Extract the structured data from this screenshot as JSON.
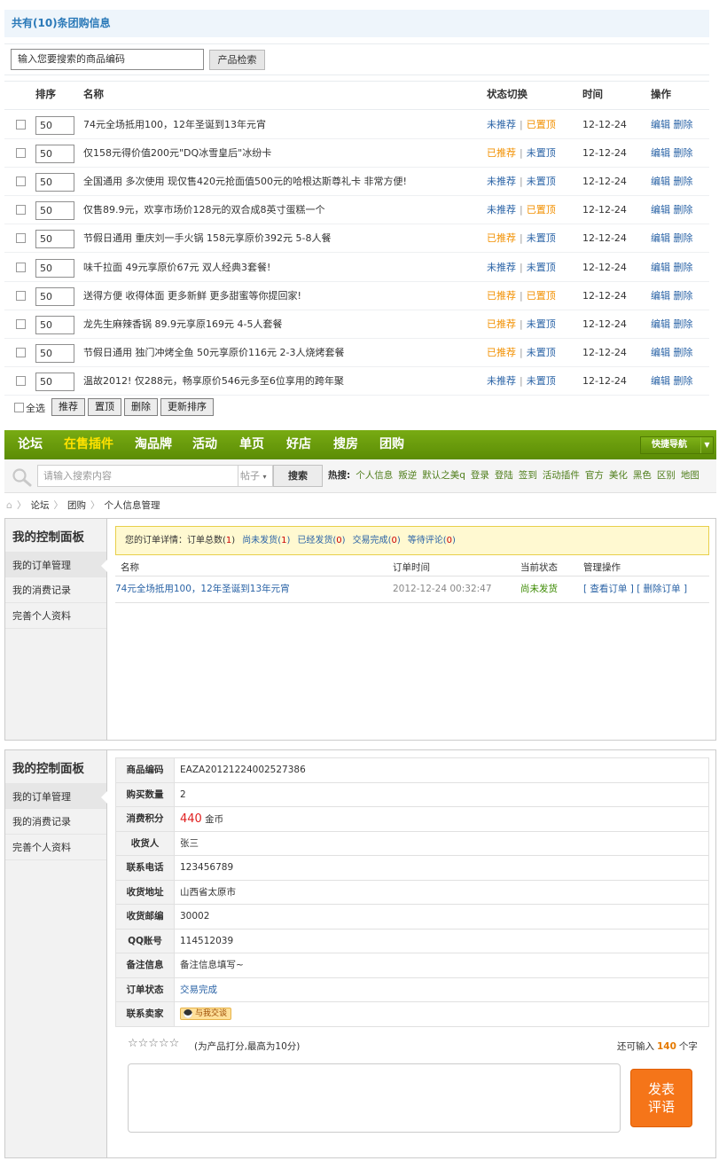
{
  "admin": {
    "header": "共有(10)条团购信息",
    "search": {
      "placeholder": "输入您要搜索的商品编码",
      "button": "产品检索"
    },
    "columns": {
      "order": "排序",
      "name": "名称",
      "status": "状态切换",
      "time": "时间",
      "action": "操作"
    },
    "rows": [
      {
        "order": "50",
        "name": "74元全场抵用100，12年圣诞到13年元宵",
        "rec": "未推荐",
        "rec_on": false,
        "top": "已置顶",
        "top_on": true,
        "time": "12-12-24"
      },
      {
        "order": "50",
        "name": "仅158元得价值200元\"DQ冰雪皇后\"冰纷卡",
        "rec": "已推荐",
        "rec_on": true,
        "top": "未置顶",
        "top_on": false,
        "time": "12-12-24"
      },
      {
        "order": "50",
        "name": "全国通用 多次使用 现仅售420元抢面值500元的哈根达斯尊礼卡 非常方便!",
        "rec": "未推荐",
        "rec_on": false,
        "top": "未置顶",
        "top_on": false,
        "time": "12-12-24"
      },
      {
        "order": "50",
        "name": "仅售89.9元，欢享市场价128元的双合成8英寸蛋糕一个",
        "rec": "未推荐",
        "rec_on": false,
        "top": "已置顶",
        "top_on": true,
        "time": "12-12-24"
      },
      {
        "order": "50",
        "name": "节假日通用 重庆刘一手火锅 158元享原价392元 5-8人餐",
        "rec": "已推荐",
        "rec_on": true,
        "top": "未置顶",
        "top_on": false,
        "time": "12-12-24"
      },
      {
        "order": "50",
        "name": "味千拉面 49元享原价67元 双人经典3套餐!",
        "rec": "未推荐",
        "rec_on": false,
        "top": "未置顶",
        "top_on": false,
        "time": "12-12-24"
      },
      {
        "order": "50",
        "name": "送得方便 收得体面 更多新鲜 更多甜蜜等你提回家!",
        "rec": "已推荐",
        "rec_on": true,
        "top": "已置顶",
        "top_on": true,
        "time": "12-12-24"
      },
      {
        "order": "50",
        "name": "龙先生麻辣香锅 89.9元享原169元 4-5人套餐",
        "rec": "已推荐",
        "rec_on": true,
        "top": "未置顶",
        "top_on": false,
        "time": "12-12-24"
      },
      {
        "order": "50",
        "name": "节假日通用 独门冲烤全鱼 50元享原价116元 2-3人烧烤套餐",
        "rec": "已推荐",
        "rec_on": true,
        "top": "未置顶",
        "top_on": false,
        "time": "12-12-24"
      },
      {
        "order": "50",
        "name": "温故2012! 仅288元，畅享原价546元多至6位享用的跨年聚",
        "rec": "未推荐",
        "rec_on": false,
        "top": "未置顶",
        "top_on": false,
        "time": "12-12-24"
      }
    ],
    "edit": "编辑",
    "delete": "删除",
    "select_all": "全选",
    "bulk": [
      "推荐",
      "置顶",
      "删除",
      "更新排序"
    ]
  },
  "forum": {
    "nav": [
      "论坛",
      "在售插件",
      "淘品牌",
      "活动",
      "单页",
      "好店",
      "搜房",
      "团购"
    ],
    "nav_active": "在售插件",
    "quick_nav": "快捷导航",
    "search_placeholder": "请输入搜索内容",
    "search_type": "帖子",
    "search_button": "搜索",
    "hot_label": "热搜:",
    "hot": [
      "个人信息",
      "叛逆",
      "默认之美q",
      "登录",
      "登陆",
      "签到",
      "活动插件",
      "官方",
      "美化",
      "黑色",
      "区别",
      "地图"
    ],
    "breadcrumb": [
      "论坛",
      "团购",
      "个人信息管理"
    ]
  },
  "panel": {
    "title": "我的控制面板",
    "menu": [
      "我的订单管理",
      "我的消费记录",
      "完善个人资料"
    ]
  },
  "orders": {
    "summary_label": "您的订单详情：订单总数",
    "total": "1",
    "tabs": [
      {
        "label": "尚未发货",
        "count": "1"
      },
      {
        "label": "已经发货",
        "count": "0"
      },
      {
        "label": "交易完成",
        "count": "0"
      },
      {
        "label": "等待评论",
        "count": "0"
      }
    ],
    "columns": {
      "name": "名称",
      "time": "订单时间",
      "status": "当前状态",
      "action": "管理操作"
    },
    "row": {
      "name": "74元全场抵用100，12年圣诞到13年元宵",
      "time": "2012-12-24 00:32:47",
      "status": "尚未发货",
      "view": "[ 查看订单 ]",
      "delete": "[ 删除订单 ]"
    }
  },
  "detail": {
    "fields": [
      {
        "k": "商品编码",
        "v": "EAZA20121224002527386"
      },
      {
        "k": "购买数量",
        "v": "2"
      },
      {
        "k": "消费积分",
        "v": "440",
        "unit": "金币"
      },
      {
        "k": "收货人",
        "v": "张三"
      },
      {
        "k": "联系电话",
        "v": "123456789"
      },
      {
        "k": "收货地址",
        "v": "山西省太原市"
      },
      {
        "k": "收货邮编",
        "v": "30002"
      },
      {
        "k": "QQ账号",
        "v": "114512039"
      },
      {
        "k": "备注信息",
        "v": "备注信息填写~"
      },
      {
        "k": "订单状态",
        "v": "交易完成"
      },
      {
        "k": "联系卖家",
        "v": "与我交谈"
      }
    ],
    "stars": "☆☆☆☆☆",
    "rate_hint": "(为产品打分,最高为10分)",
    "remain_pre": "还可输入",
    "remain_count": "140",
    "remain_post": "个字",
    "submit_line1": "发表",
    "submit_line2": "评语"
  },
  "colors": {
    "link": "#2a63a6",
    "orange": "#f29000",
    "nav_green": "#6a9c0c",
    "status_green": "#3b8a00",
    "submit": "#f57519"
  }
}
